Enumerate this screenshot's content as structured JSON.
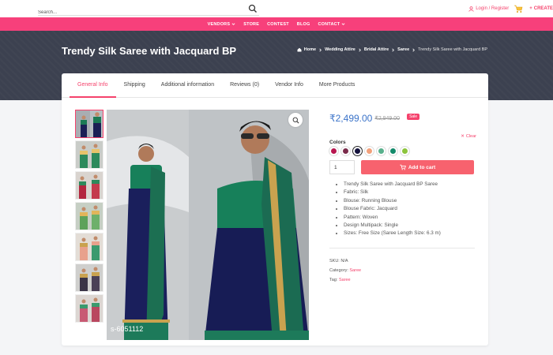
{
  "topbar": {
    "search_placeholder": "Search...",
    "login_label": "Login / Register",
    "create_label": "CREATE"
  },
  "nav": {
    "items": [
      {
        "label": "VENDORS",
        "has_dropdown": true
      },
      {
        "label": "STORE",
        "has_dropdown": false
      },
      {
        "label": "CONTEST",
        "has_dropdown": false
      },
      {
        "label": "BLOG",
        "has_dropdown": false
      },
      {
        "label": "CONTACT",
        "has_dropdown": true
      }
    ]
  },
  "header": {
    "title": "Trendy Silk Saree with Jacquard BP",
    "breadcrumb": [
      "Home",
      "Wedding Attire",
      "Bridal Attire",
      "Saree",
      "Trendy Silk Saree with Jacquard BP"
    ]
  },
  "tabs": [
    {
      "label": "General Info",
      "active": true
    },
    {
      "label": "Shipping",
      "active": false
    },
    {
      "label": "Additional information",
      "active": false
    },
    {
      "label": "Reviews (0)",
      "active": false
    },
    {
      "label": "Vendor Info",
      "active": false
    },
    {
      "label": "More Products",
      "active": false
    }
  ],
  "gallery": {
    "thumbnail_count": 7,
    "watermark": "s-6051112"
  },
  "product": {
    "price": "₹2,499.00",
    "old_price": "₹2,949.00",
    "sale_badge": "Sale",
    "colors_label": "Colors",
    "clear_label": "Clear",
    "colors": [
      "#b8164f",
      "#7a2a4a",
      "#14123d",
      "#f2a07b",
      "#58b08c",
      "#138a6a",
      "#8cc43c"
    ],
    "selected_color_index": 2,
    "quantity": "1",
    "add_to_cart_label": "Add to cart",
    "features": [
      "Trendy Silk Saree with Jacquard BP Saree",
      "Fabric: Silk",
      "Blouse: Running Blouse",
      "Blouse Fabric: Jacquard",
      "Pattern: Woven",
      "Design Multipack: Single",
      "Sizes: Free Size (Saree Length Size: 6.3 m)"
    ],
    "sku_label": "SKU:",
    "sku_value": "N/A",
    "category_label": "Category:",
    "category_value": "Saree",
    "tag_label": "Tag:",
    "tag_value": "Saree"
  },
  "colors": {
    "accent": "#f5426c",
    "nav_bg": "#f7407b",
    "header_bg": "#3c4150",
    "price": "#3b73c9"
  }
}
